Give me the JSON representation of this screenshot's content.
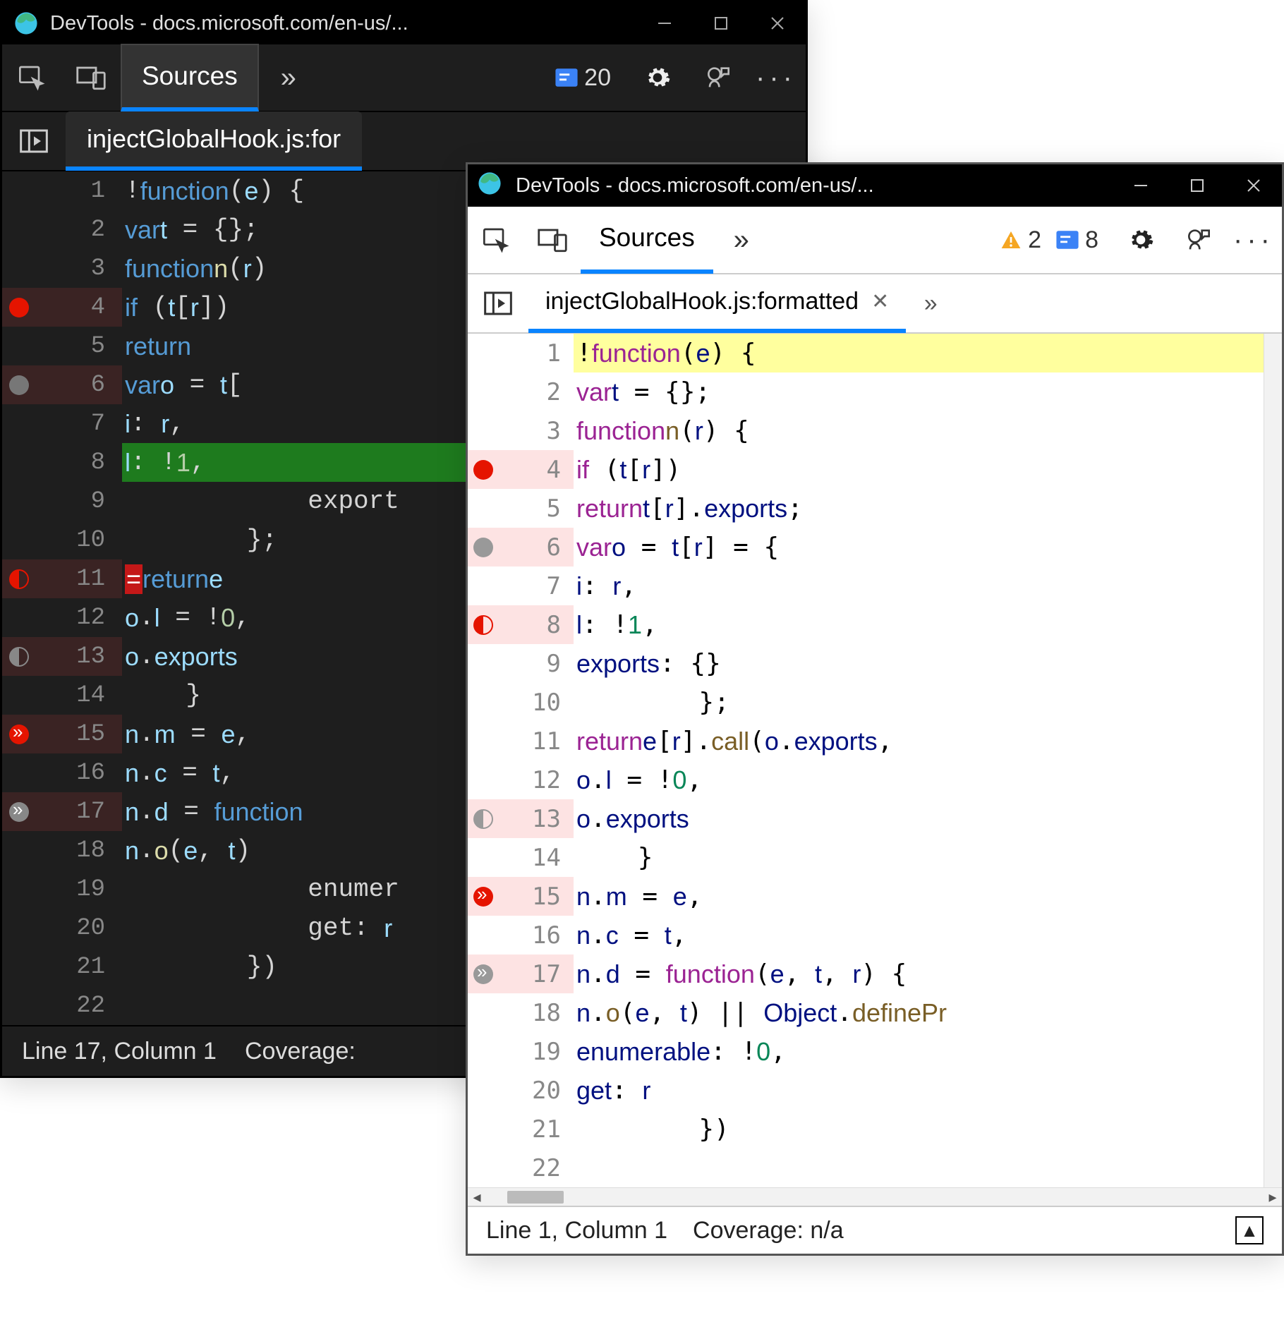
{
  "dark": {
    "title": "DevTools - docs.microsoft.com/en-us/...",
    "tab": "Sources",
    "issues_count": "20",
    "file_tab": "injectGlobalHook.js:for",
    "status": {
      "pos": "Line 17, Column 1",
      "cov": "Coverage:"
    },
    "lines": [
      {
        "n": "1"
      },
      {
        "n": "2"
      },
      {
        "n": "3"
      },
      {
        "n": "4",
        "bp": "red",
        "hit": true
      },
      {
        "n": "5"
      },
      {
        "n": "6",
        "bp": "grey",
        "hit": true
      },
      {
        "n": "7"
      },
      {
        "n": "8",
        "exec": true
      },
      {
        "n": "9"
      },
      {
        "n": "10"
      },
      {
        "n": "11",
        "bp": "half",
        "hit": true
      },
      {
        "n": "12"
      },
      {
        "n": "13",
        "bp": "halfgrey",
        "hit": true
      },
      {
        "n": "14"
      },
      {
        "n": "15",
        "bp": "arrow",
        "hit": true
      },
      {
        "n": "16"
      },
      {
        "n": "17",
        "bp": "arrowgrey",
        "hit": true
      },
      {
        "n": "18"
      },
      {
        "n": "19"
      },
      {
        "n": "20"
      },
      {
        "n": "21"
      },
      {
        "n": "22"
      }
    ]
  },
  "light": {
    "title": "DevTools - docs.microsoft.com/en-us/...",
    "tab": "Sources",
    "warn_count": "2",
    "issues_count": "8",
    "file_tab": "injectGlobalHook.js:formatted",
    "status": {
      "pos": "Line 1, Column 1",
      "cov": "Coverage: n/a"
    },
    "lines": [
      {
        "n": "1",
        "hl": true
      },
      {
        "n": "2"
      },
      {
        "n": "3"
      },
      {
        "n": "4",
        "bp": "red",
        "hit": true
      },
      {
        "n": "5"
      },
      {
        "n": "6",
        "bp": "grey",
        "hit": true
      },
      {
        "n": "7"
      },
      {
        "n": "8",
        "bp": "half",
        "hit": true
      },
      {
        "n": "9"
      },
      {
        "n": "10"
      },
      {
        "n": "11"
      },
      {
        "n": "12"
      },
      {
        "n": "13",
        "bp": "halfgrey",
        "hit": true
      },
      {
        "n": "14"
      },
      {
        "n": "15",
        "bp": "arrow",
        "hit": true
      },
      {
        "n": "16"
      },
      {
        "n": "17",
        "bp": "arrowgrey",
        "hit": true
      },
      {
        "n": "18"
      },
      {
        "n": "19"
      },
      {
        "n": "20"
      },
      {
        "n": "21"
      },
      {
        "n": "22"
      }
    ]
  },
  "code_dark": [
    "!<kw>function</kw>(<id>e</id>) {",
    "    <kw>var</kw> <id>t</id> = {};",
    "    <kw>function</kw> <fn>n</fn>(<id>r</id>) ",
    "        <kw>if</kw> (<id>t</id>[<id>r</id>])",
    "            <kw>return</kw> ",
    "        <kw>var</kw> <id>o</id> = <id>t</id>[",
    "            <id>i</id>: <id>r</id>,",
    "            <id>l</id>: !<num>1</num>,",
    "            export",
    "        };",
    "        <err>=</err><kw>return</kw> <id>e</id>",
    "        <id>o</id>.<id>l</id> = !<num>0</num>,",
    "        <id>o</id>.<id>exports</id>",
    "    }",
    "    <id>n</id>.<id>m</id> = <id>e</id>,",
    "    <id>n</id>.<id>c</id> = <id>t</id>,",
    "    <id>n</id>.<id>d</id> = <kw>function</kw>",
    "        <id>n</id>.<fn>o</fn>(<id>e</id>, <id>t</id>)",
    "            enumer",
    "            get: <id>r</id>",
    "        })",
    ""
  ],
  "code_light": [
    "!<kw>function</kw>(<id>e</id>) {",
    "    <kw>var</kw> <id>t</id> = {};",
    "    <kw>function</kw> <fn>n</fn>(<id>r</id>) {",
    "        <kw>if</kw> (<id>t</id>[<id>r</id>])",
    "            <kw>return</kw> <id>t</id>[<id>r</id>].<id>exports</id>;",
    "        <kw>var</kw> <id>o</id> = <id>t</id>[<id>r</id>] = {",
    "            <id>i</id>: <id>r</id>,",
    "            <id>l</id>: !<num>1</num>,",
    "            <id>exports</id>: {}",
    "        };",
    "        <kw>return</kw> <id>e</id>[<id>r</id>].<fn>call</fn>(<id>o</id>.<id>exports</id>,",
    "        <id>o</id>.<id>l</id> = !<num>0</num>,",
    "        <id>o</id>.<id>exports</id>",
    "    }",
    "    <id>n</id>.<id>m</id> = <id>e</id>,",
    "    <id>n</id>.<id>c</id> = <id>t</id>,",
    "    <id>n</id>.<id>d</id> = <kw>function</kw>(<id>e</id>, <id>t</id>, <id>r</id>) {",
    "        <id>n</id>.<fn>o</fn>(<id>e</id>, <id>t</id>) || <id>Object</id>.<fn>definePr</fn>",
    "            <id>enumerable</id>: !<num>0</num>,",
    "            <id>get</id>: <id>r</id>",
    "        })",
    ""
  ]
}
